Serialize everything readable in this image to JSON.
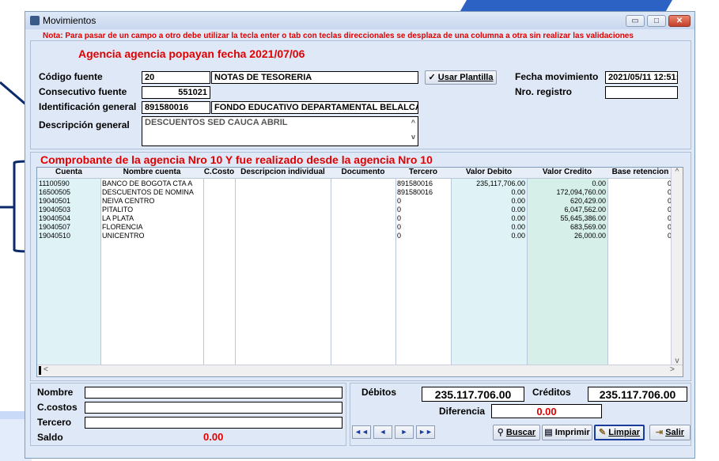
{
  "window": {
    "title": "Movimientos",
    "controls": {
      "minimize": "▭",
      "maximize": "□",
      "close": "✕"
    }
  },
  "note": "Nota: Para pasar de un campo a otro debe utilizar la tecla enter o tab  con teclas direccionales se desplaza de una columna  a otra sin realizar las validaciones",
  "agency_heading": "Agencia agencia popayan fecha 2021/07/06",
  "form": {
    "codigo_fuente": {
      "label": "Código fuente",
      "code": "20",
      "name": "NOTAS DE TESORERIA"
    },
    "usar_plantilla": {
      "check": "✓",
      "label": "Usar Plantilla"
    },
    "fecha_movimiento": {
      "label": "Fecha movimiento",
      "value": "2021/05/11 12:51:"
    },
    "consecutivo_fuente": {
      "label": "Consecutivo fuente",
      "value": "551021"
    },
    "nro_registro": {
      "label": "Nro. registro",
      "value": ""
    },
    "identificacion_general": {
      "label": "Identificación general",
      "id": "891580016",
      "name": "FONDO EDUCATIVO DEPARTAMENTAL BELALCAZAR"
    },
    "descripcion_general": {
      "label": "Descripción general",
      "value": "DESCUENTOS SED CAUCA ABRIL"
    }
  },
  "comprobante_heading": "Comprobante de la agencia Nro 10 Y fue realizado desde la agencia Nro 10",
  "grid": {
    "columns": [
      "Cuenta",
      "Nombre cuenta",
      "C.Costo",
      "Descripcion individual",
      "Documento",
      "Tercero",
      "Valor Debito",
      "Valor Credito",
      "Base retencion"
    ],
    "rows": [
      {
        "cuenta": "11100590",
        "nombre": "BANCO DE BOGOTA CTA A",
        "ccosto": "",
        "desc": "",
        "doc": "",
        "tercero": "891580016",
        "debito": "235,117,706.00",
        "credito": "0.00",
        "base": "0"
      },
      {
        "cuenta": "16500505",
        "nombre": "DESCUENTOS DE NOMINA",
        "ccosto": "",
        "desc": "",
        "doc": "",
        "tercero": "891580016",
        "debito": "0.00",
        "credito": "172,094,760.00",
        "base": "0"
      },
      {
        "cuenta": "19040501",
        "nombre": "NEIVA CENTRO",
        "ccosto": "",
        "desc": "",
        "doc": "",
        "tercero": "0",
        "debito": "0.00",
        "credito": "620,429.00",
        "base": "0"
      },
      {
        "cuenta": "19040503",
        "nombre": "PITALITO",
        "ccosto": "",
        "desc": "",
        "doc": "",
        "tercero": "0",
        "debito": "0.00",
        "credito": "6,047,562.00",
        "base": "0"
      },
      {
        "cuenta": "19040504",
        "nombre": "LA PLATA",
        "ccosto": "",
        "desc": "",
        "doc": "",
        "tercero": "0",
        "debito": "0.00",
        "credito": "55,645,386.00",
        "base": "0"
      },
      {
        "cuenta": "19040507",
        "nombre": "FLORENCIA",
        "ccosto": "",
        "desc": "",
        "doc": "",
        "tercero": "0",
        "debito": "0.00",
        "credito": "683,569.00",
        "base": "0"
      },
      {
        "cuenta": "19040510",
        "nombre": "UNICENTRO",
        "ccosto": "",
        "desc": "",
        "doc": "",
        "tercero": "0",
        "debito": "0.00",
        "credito": "26,000.00",
        "base": "0"
      }
    ],
    "scroll_left": "<",
    "scroll_right": ">",
    "scroll_up": "^",
    "scroll_down": "v"
  },
  "bottom": {
    "nombre_label": "Nombre",
    "ccostos_label": "C.costos",
    "tercero_label": "Tercero",
    "saldo_label": "Saldo",
    "saldo_value": "0.00",
    "debitos_label": "Débitos",
    "debitos_value": "235.117.706.00",
    "creditos_label": "Créditos",
    "creditos_value": "235.117.706.00",
    "diferencia_label": "Diferencia",
    "diferencia_value": "0.00"
  },
  "nav": {
    "first": "◄◄",
    "prev": "◄",
    "next": "►",
    "last": "►►"
  },
  "actions": {
    "buscar": "Buscar",
    "imprimir": "Imprimir",
    "limpiar": "Limpiar",
    "salir": "Salir"
  },
  "colors": {
    "accent_red": "#e00000",
    "debit_col": "#dff2f5",
    "credit_col": "#d6efe9",
    "cuenta_col": "#dff2f5"
  }
}
